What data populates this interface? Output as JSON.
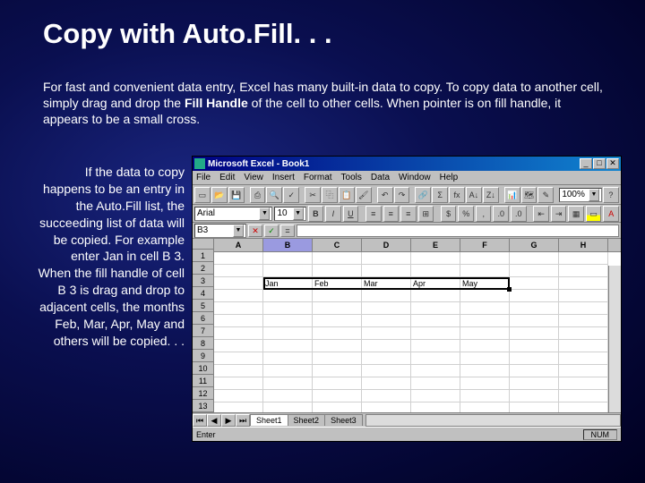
{
  "slide": {
    "title": "Copy with Auto.Fill. . .",
    "para1_a": "For fast and convenient data entry, Excel has many built-in data to copy.  To copy data to another cell, simply drag and drop the ",
    "para1_b": "Fill Handle",
    "para1_c": " of the cell to other cells. When pointer is on fill handle, it appears to be a small cross.",
    "para2": "If the data to copy happens to be an entry in the Auto.Fill list, the succeeding list of data will be copied. For example enter Jan in cell B 3. When the fill handle of cell B 3 is drag and drop to adjacent cells, the months Feb, Mar, Apr, May and others will be copied. . ."
  },
  "excel": {
    "title": "Microsoft Excel - Book1",
    "menus": [
      "File",
      "Edit",
      "View",
      "Insert",
      "Format",
      "Tools",
      "Data",
      "Window",
      "Help"
    ],
    "font": "Arial",
    "fontsize": "10",
    "zoom": "100%",
    "namebox": "B3",
    "formula_btns": {
      "cancel": "✕",
      "confirm": "✓",
      "equals": "="
    },
    "fmt_btns": {
      "bold": "B",
      "italic": "I",
      "underline": "U",
      "color_a": "A"
    },
    "columns": [
      "A",
      "B",
      "C",
      "D",
      "E",
      "F",
      "G",
      "H"
    ],
    "active_col": "B",
    "rows": [
      "1",
      "2",
      "3",
      "4",
      "5",
      "6",
      "7",
      "8",
      "9",
      "10",
      "11",
      "12",
      "13"
    ],
    "data_row3": [
      "",
      "Jan",
      "Feb",
      "Mar",
      "Apr",
      "May",
      "",
      ""
    ],
    "tabs": [
      "Sheet1",
      "Sheet2",
      "Sheet3"
    ],
    "status_left": "Enter",
    "status_num": "NUM"
  }
}
